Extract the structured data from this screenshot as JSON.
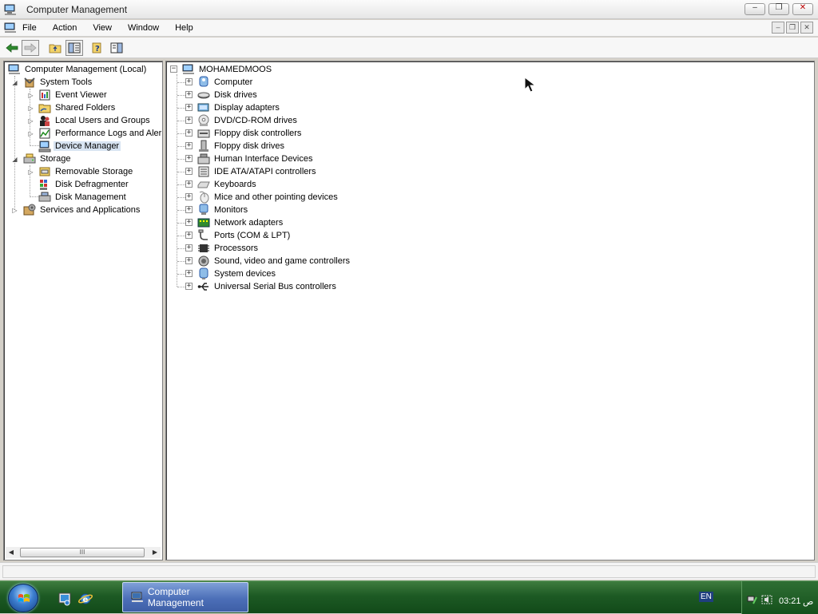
{
  "window": {
    "title": "Computer Management",
    "controls": {
      "minimize": "–",
      "restore": "❐",
      "close": "✕"
    }
  },
  "menu": {
    "items": [
      "File",
      "Action",
      "View",
      "Window",
      "Help"
    ]
  },
  "left_tree": [
    {
      "label": "Computer Management (Local)",
      "icon": "computer-management-icon"
    },
    {
      "label": "System Tools",
      "icon": "system-tools-icon"
    },
    {
      "label": "Event Viewer",
      "icon": "event-viewer-icon"
    },
    {
      "label": "Shared Folders",
      "icon": "shared-folders-icon"
    },
    {
      "label": "Local Users and Groups",
      "icon": "local-users-icon"
    },
    {
      "label": "Performance Logs and Aler",
      "icon": "performance-logs-icon"
    },
    {
      "label": "Device Manager",
      "icon": "device-manager-icon",
      "selected": true
    },
    {
      "label": "Storage",
      "icon": "storage-icon"
    },
    {
      "label": "Removable Storage",
      "icon": "removable-storage-icon"
    },
    {
      "label": "Disk Defragmenter",
      "icon": "disk-defragmenter-icon"
    },
    {
      "label": "Disk Management",
      "icon": "disk-management-icon"
    },
    {
      "label": "Services and Applications",
      "icon": "services-applications-icon"
    }
  ],
  "left_scroll": {
    "thumb_grip": "III"
  },
  "device_tree": {
    "root": "MOHAMEDMOOS",
    "categories": [
      {
        "label": "Computer",
        "icon": "computer-icon"
      },
      {
        "label": "Disk drives",
        "icon": "disk-drive-icon"
      },
      {
        "label": "Display adapters",
        "icon": "display-adapter-icon"
      },
      {
        "label": "DVD/CD-ROM drives",
        "icon": "dvd-drive-icon"
      },
      {
        "label": "Floppy disk controllers",
        "icon": "floppy-controller-icon"
      },
      {
        "label": "Floppy disk drives",
        "icon": "floppy-drive-icon"
      },
      {
        "label": "Human Interface Devices",
        "icon": "hid-icon"
      },
      {
        "label": "IDE ATA/ATAPI controllers",
        "icon": "ide-controller-icon"
      },
      {
        "label": "Keyboards",
        "icon": "keyboard-icon"
      },
      {
        "label": "Mice and other pointing devices",
        "icon": "mouse-icon"
      },
      {
        "label": "Monitors",
        "icon": "monitor-icon"
      },
      {
        "label": "Network adapters",
        "icon": "network-adapter-icon"
      },
      {
        "label": "Ports (COM & LPT)",
        "icon": "port-icon"
      },
      {
        "label": "Processors",
        "icon": "processor-icon"
      },
      {
        "label": "Sound, video and game controllers",
        "icon": "sound-icon"
      },
      {
        "label": "System devices",
        "icon": "system-devices-icon"
      },
      {
        "label": "Universal Serial Bus controllers",
        "icon": "usb-icon"
      }
    ]
  },
  "taskbar": {
    "active_task": "Computer Management",
    "language": "EN",
    "time": "03:21",
    "ampm": "ص"
  },
  "colors": {
    "selection": "#d8e4f2",
    "taskbar": "#1d5a24",
    "task_button": "#4c6fb8"
  }
}
